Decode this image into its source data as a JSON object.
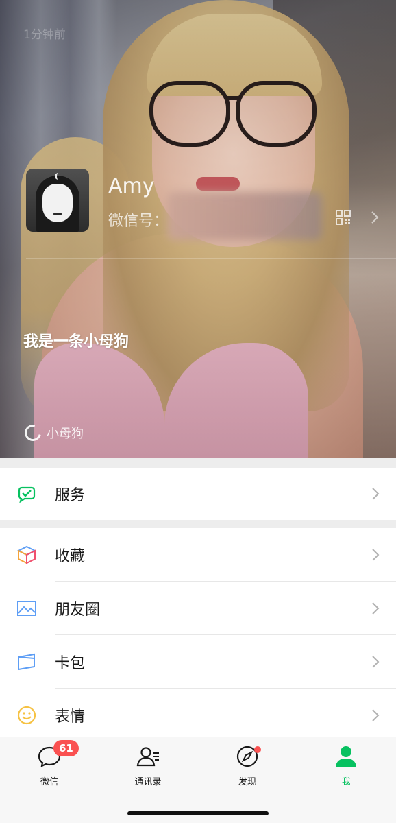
{
  "header": {
    "timestamp": "1分钟前",
    "profile": {
      "name": "Amy",
      "wechat_id_label": "微信号："
    },
    "status": {
      "text": "我是一条小母狗",
      "chip_label": "小母狗"
    }
  },
  "menu": {
    "group1": [
      {
        "label": "服务",
        "icon": "service-icon"
      }
    ],
    "group2": [
      {
        "label": "收藏",
        "icon": "favorites-icon"
      },
      {
        "label": "朋友圈",
        "icon": "moments-icon"
      },
      {
        "label": "卡包",
        "icon": "cards-icon"
      },
      {
        "label": "表情",
        "icon": "stickers-icon"
      }
    ]
  },
  "tabbar": {
    "tabs": [
      {
        "label": "微信",
        "icon": "chat-icon",
        "badge": "61"
      },
      {
        "label": "通讯录",
        "icon": "contacts-icon"
      },
      {
        "label": "发现",
        "icon": "discover-icon"
      },
      {
        "label": "我",
        "icon": "me-icon",
        "active": true
      }
    ]
  },
  "colors": {
    "accent": "#07c160",
    "badge": "#fa5151",
    "background": "#ededed"
  }
}
